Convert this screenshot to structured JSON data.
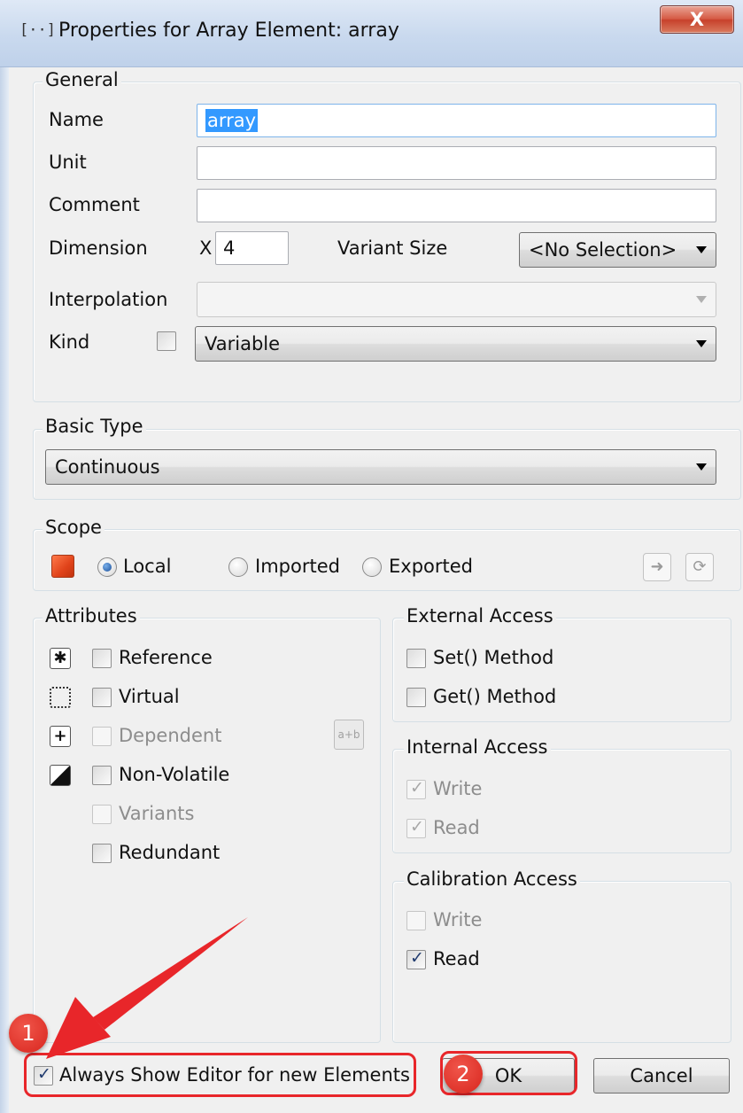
{
  "window": {
    "title_icon": "[··]",
    "title": "Properties for Array Element: array",
    "close_label": "X"
  },
  "general": {
    "legend": "General",
    "name_label": "Name",
    "name_value": "array",
    "unit_label": "Unit",
    "unit_value": "",
    "comment_label": "Comment",
    "comment_value": "",
    "dimension_label": "Dimension",
    "dimension_x_label": "X",
    "dimension_value": "4",
    "variant_size_label": "Variant Size",
    "variant_size_value": "<No Selection>",
    "interpolation_label": "Interpolation",
    "interpolation_value": "",
    "kind_label": "Kind",
    "kind_value": "Variable"
  },
  "basic_type": {
    "legend": "Basic Type",
    "value": "Continuous"
  },
  "scope": {
    "legend": "Scope",
    "color": "#e0431a",
    "local_label": "Local",
    "local_selected": true,
    "imported_label": "Imported",
    "exported_label": "Exported"
  },
  "attributes": {
    "legend": "Attributes",
    "items": [
      {
        "label": "Reference",
        "checked": false,
        "enabled": true,
        "icon": "asterisk-icon"
      },
      {
        "label": "Virtual",
        "checked": false,
        "enabled": true,
        "icon": "dashed-box-icon"
      },
      {
        "label": "Dependent",
        "checked": false,
        "enabled": false,
        "icon": "plus-icon"
      },
      {
        "label": "Non-Volatile",
        "checked": false,
        "enabled": true,
        "icon": "triangle-icon"
      },
      {
        "label": "Variants",
        "checked": false,
        "enabled": false,
        "icon": ""
      },
      {
        "label": "Redundant",
        "checked": false,
        "enabled": true,
        "icon": ""
      }
    ]
  },
  "external_access": {
    "legend": "External Access",
    "set_label": "Set() Method",
    "get_label": "Get() Method"
  },
  "internal_access": {
    "legend": "Internal Access",
    "write_label": "Write",
    "read_label": "Read"
  },
  "calibration_access": {
    "legend": "Calibration Access",
    "write_label": "Write",
    "read_label": "Read"
  },
  "footer": {
    "always_show_label": "Always Show Editor for new Elements",
    "always_show_checked": true,
    "ok_label": "OK",
    "cancel_label": "Cancel"
  },
  "annotations": {
    "badge_1": "1",
    "badge_2": "2",
    "color": "#e8262a"
  }
}
